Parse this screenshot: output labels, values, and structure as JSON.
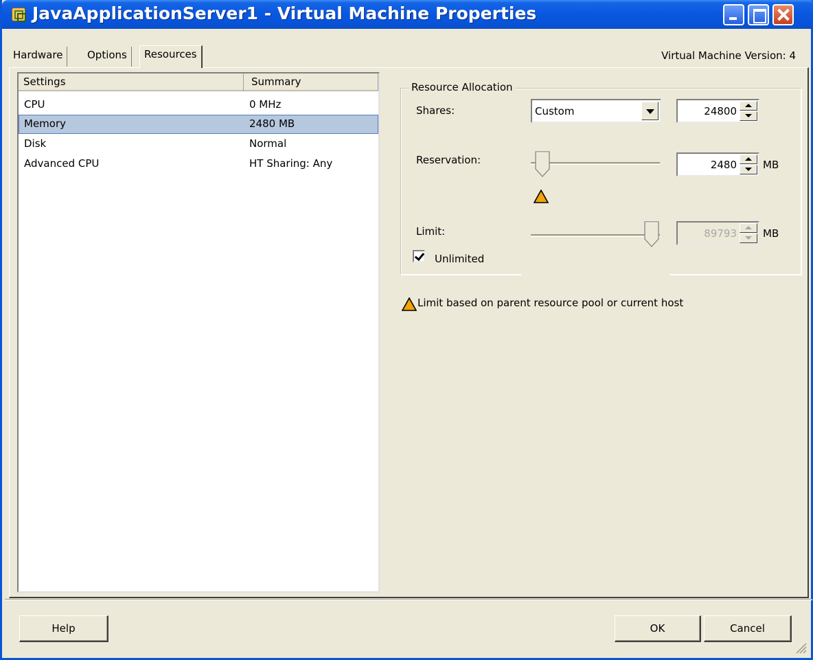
{
  "window": {
    "title": "JavaApplicationServer1 - Virtual Machine Properties"
  },
  "tabs": [
    {
      "label": "Hardware",
      "selected": false
    },
    {
      "label": "Options",
      "selected": false
    },
    {
      "label": "Resources",
      "selected": true
    }
  ],
  "vm_version": "Virtual Machine Version: 4",
  "settings_list": {
    "headers": [
      "Settings",
      "Summary"
    ],
    "rows": [
      {
        "setting": "CPU",
        "summary": "0 MHz",
        "selected": false
      },
      {
        "setting": "Memory",
        "summary": "2480 MB",
        "selected": true
      },
      {
        "setting": "Disk",
        "summary": "Normal",
        "selected": false
      },
      {
        "setting": "Advanced CPU",
        "summary": "HT Sharing: Any",
        "selected": false
      }
    ]
  },
  "resource_allocation": {
    "group_label": "Resource Allocation",
    "shares": {
      "label": "Shares:",
      "selected_option": "Custom",
      "value": "24800"
    },
    "reservation": {
      "label": "Reservation:",
      "value": "2480",
      "unit": "MB",
      "slider_level": 0.0
    },
    "limit": {
      "label": "Limit:",
      "value": "89793",
      "unit": "MB",
      "slider_level": 1.0,
      "disabled": true
    },
    "unlimited": {
      "label": "Unlimited",
      "checked": true
    }
  },
  "note": "Limit based on parent resource pool or current host",
  "buttons": {
    "help": "Help",
    "ok": "OK",
    "cancel": "Cancel"
  },
  "colors": {
    "title_bar": "#0a58e0",
    "selection": "#b6c8de",
    "warning": "#f0a30a",
    "face": "#ece9d8"
  }
}
